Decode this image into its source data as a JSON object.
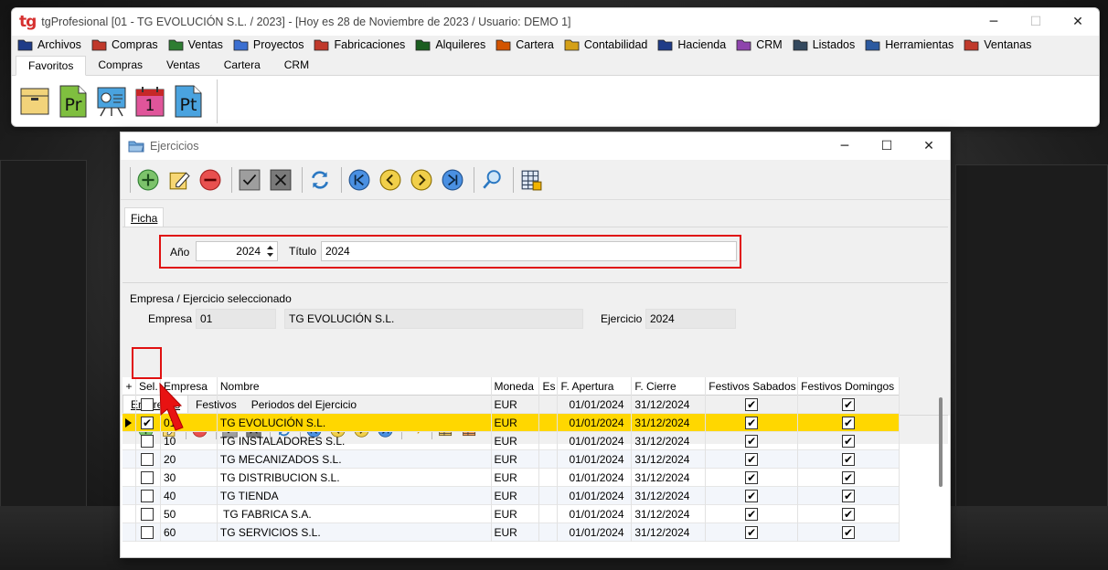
{
  "app": {
    "logo": "tg",
    "title": "tgProfesional [01 - TG EVOLUCIÓN S.L. / 2023] - [Hoy es 28 de Noviembre de 2023 / Usuario: DEMO 1]",
    "window_controls": [
      "─",
      "☐",
      "✕"
    ]
  },
  "menu": [
    {
      "label": "Archivos",
      "icon": "archive-folder-icon",
      "color": "#1f3c88"
    },
    {
      "label": "Compras",
      "icon": "folder-red-icon",
      "color": "#c0392b"
    },
    {
      "label": "Ventas",
      "icon": "folder-green-icon",
      "color": "#2e7d32"
    },
    {
      "label": "Proyectos",
      "icon": "folder-blue-icon",
      "color": "#3b6fd1"
    },
    {
      "label": "Fabricaciones",
      "icon": "factory-icon",
      "color": "#c0392b"
    },
    {
      "label": "Alquileres",
      "icon": "folder-darkgreen-icon",
      "color": "#1b5e20"
    },
    {
      "label": "Cartera",
      "icon": "folder-multicolor-icon",
      "color": "#d35400"
    },
    {
      "label": "Contabilidad",
      "icon": "folder-yellow-icon",
      "color": "#d4a017"
    },
    {
      "label": "Hacienda",
      "icon": "tax-calculator-icon",
      "color": "#1f3c88"
    },
    {
      "label": "CRM",
      "icon": "folder-purple-icon",
      "color": "#8e44ad"
    },
    {
      "label": "Listados",
      "icon": "printer-icon",
      "color": "#34495e"
    },
    {
      "label": "Herramientas",
      "icon": "gear-icon",
      "color": "#2c5aa0"
    },
    {
      "label": "Ventanas",
      "icon": "close-window-icon",
      "color": "#c0392b"
    }
  ],
  "ribbon_tabs": [
    "Favoritos",
    "Compras",
    "Ventas",
    "Cartera",
    "CRM"
  ],
  "ribbon_icons": [
    {
      "name": "box-icon",
      "text": ""
    },
    {
      "name": "pr-document-icon",
      "text": "Pr"
    },
    {
      "name": "presentation-icon",
      "text": ""
    },
    {
      "name": "calendar-icon",
      "text": "1"
    },
    {
      "name": "pt-document-icon",
      "text": "Pt"
    }
  ],
  "ejercicios": {
    "title": "Ejercicios",
    "window_controls": [
      "─",
      "☐",
      "✕"
    ],
    "toolbar": [
      "add-icon",
      "edit-icon",
      "delete-icon",
      "confirm-icon",
      "cancel-icon",
      "refresh-icon",
      "first-record-icon",
      "previous-record-icon",
      "next-record-icon",
      "last-record-icon",
      "search-icon",
      "grid-view-icon"
    ],
    "ficha_tab": "Ficha",
    "ano_label": "Año",
    "ano_value": "2024",
    "titulo_label": "Título",
    "titulo_value": "2024",
    "group_title": "Empresa / Ejercicio seleccionado",
    "empresa_label": "Empresa",
    "empresa_code": "01",
    "empresa_name": "TG EVOLUCIÓN S.L.",
    "ejercicio_label": "Ejercicio",
    "ejercicio_value": "2024",
    "grid_tabs": [
      "Empresas",
      "Festivos",
      "Periodos del Ejercicio"
    ],
    "grid_toolbar": [
      "add-icon",
      "edit-icon",
      "delete-icon",
      "confirm-icon",
      "cancel-icon",
      "refresh-icon",
      "first-record-icon",
      "previous-record-icon",
      "next-record-icon",
      "last-record-icon",
      "return-arrow-icon",
      "grid-export-icon",
      "grid-config-icon"
    ],
    "columns": [
      "+",
      "Sel.",
      "Empresa",
      "Nombre",
      "Moneda",
      "Es",
      "F. Apertura",
      "F. Cierre",
      "Festivos Sabados",
      "Festivos Domingos"
    ],
    "rows": [
      {
        "sel": false,
        "empresa": "",
        "nombre": "",
        "moneda": "EUR",
        "es": "",
        "apertura": "01/01/2024",
        "cierre": "31/12/2024",
        "sab": true,
        "dom": true,
        "current": false
      },
      {
        "sel": true,
        "empresa": "01",
        "nombre": "TG EVOLUCIÓN S.L.",
        "moneda": "EUR",
        "es": "",
        "apertura": "01/01/2024",
        "cierre": "31/12/2024",
        "sab": true,
        "dom": true,
        "current": true
      },
      {
        "sel": false,
        "empresa": "10",
        "nombre": "TG INSTALADORES S.L.",
        "moneda": "EUR",
        "es": "",
        "apertura": "01/01/2024",
        "cierre": "31/12/2024",
        "sab": true,
        "dom": true,
        "current": false
      },
      {
        "sel": false,
        "empresa": "20",
        "nombre": "TG MECANIZADOS S.L.",
        "moneda": "EUR",
        "es": "",
        "apertura": "01/01/2024",
        "cierre": "31/12/2024",
        "sab": true,
        "dom": true,
        "current": false
      },
      {
        "sel": false,
        "empresa": "30",
        "nombre": "TG DISTRIBUCION S.L.",
        "moneda": "EUR",
        "es": "",
        "apertura": "01/01/2024",
        "cierre": "31/12/2024",
        "sab": true,
        "dom": true,
        "current": false
      },
      {
        "sel": false,
        "empresa": "40",
        "nombre": "TG TIENDA",
        "moneda": "EUR",
        "es": "",
        "apertura": "01/01/2024",
        "cierre": "31/12/2024",
        "sab": true,
        "dom": true,
        "current": false
      },
      {
        "sel": false,
        "empresa": "50",
        "nombre": " TG FABRICA S.A.",
        "moneda": "EUR",
        "es": "",
        "apertura": "01/01/2024",
        "cierre": "31/12/2024",
        "sab": true,
        "dom": true,
        "current": false
      },
      {
        "sel": false,
        "empresa": "60",
        "nombre": "TG SERVICIOS S.L.",
        "moneda": "EUR",
        "es": "",
        "apertura": "01/01/2024",
        "cierre": "31/12/2024",
        "sab": true,
        "dom": true,
        "current": false
      }
    ]
  },
  "colors": {
    "highlight_red": "#e01010",
    "selected_row": "#ffd700",
    "accent_logo": "#d6302f"
  }
}
